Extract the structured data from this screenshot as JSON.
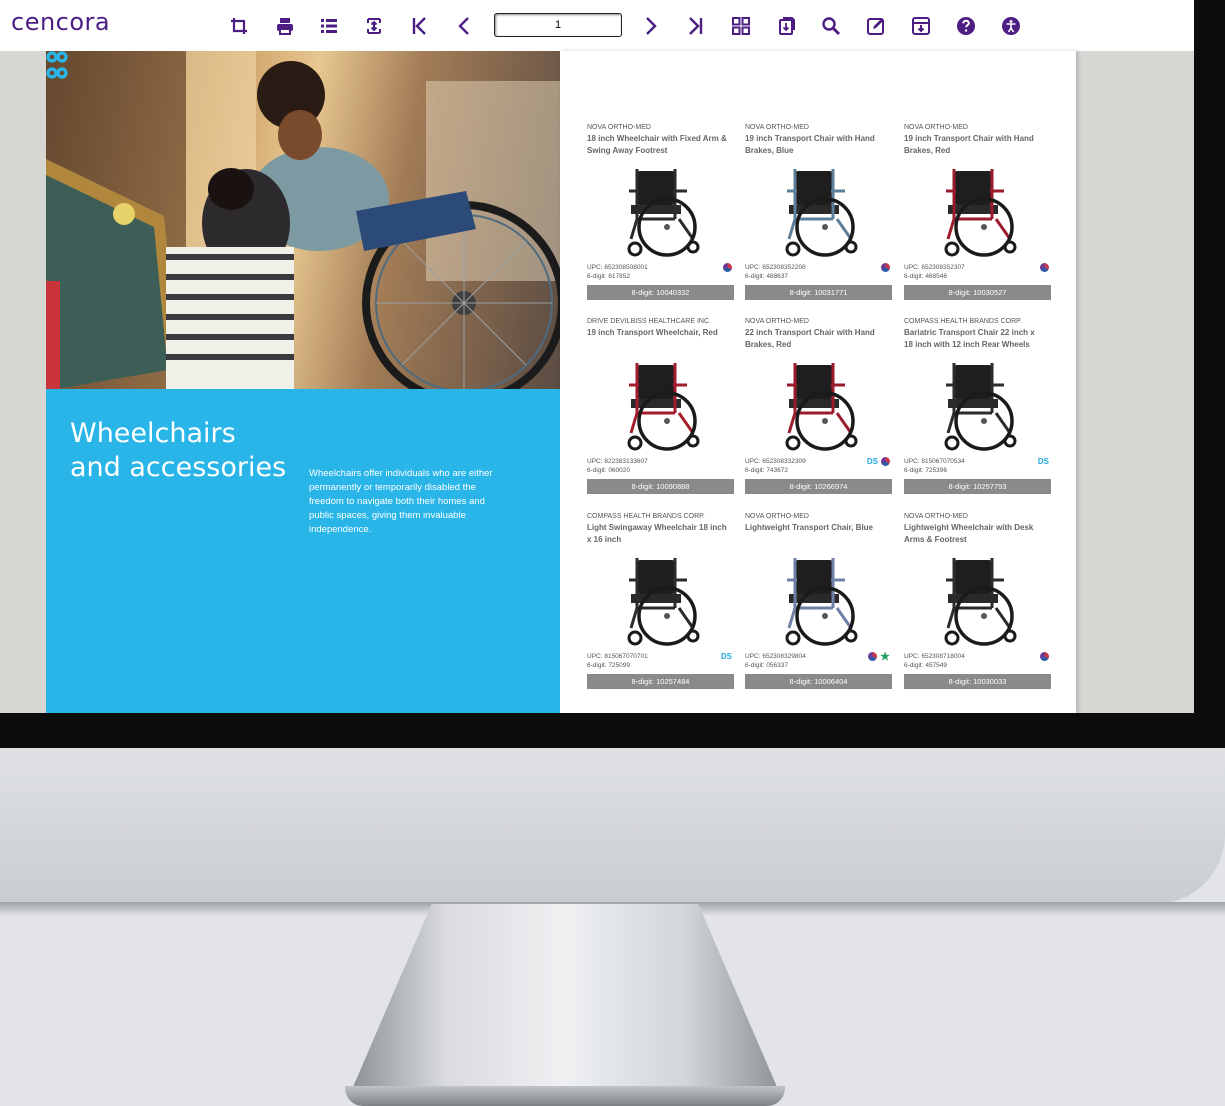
{
  "toolbar": {
    "brand": "cencora",
    "page_number": "1",
    "icons": [
      "crop-icon",
      "print-icon",
      "list-icon",
      "fit-page-icon",
      "first-page-icon",
      "previous-page-icon",
      "next-page-icon",
      "last-page-icon",
      "thumbnails-icon",
      "download-icon",
      "search-icon",
      "edit-icon",
      "archive-icon",
      "help-icon",
      "accessibility-icon"
    ]
  },
  "left_page": {
    "title_line1": "Wheelchairs",
    "title_line2": "and accessories",
    "description": "Wheelchairs offer individuals who are either permanently or temporarily disabled the freedom to navigate both their homes and public spaces, giving them invaluable independence."
  },
  "products": [
    {
      "brand": "NOVA ORTHO-MED",
      "name": "18 inch Wheelchair with Fixed Arm & Swing Away Footrest",
      "upc": "UPC: 652308508001",
      "six_digit": "6-digit: 617852",
      "eight_digit": "8-digit: 10040332",
      "badge_text": "",
      "globe": true,
      "star": false,
      "frame_color": "#2b2b2b"
    },
    {
      "brand": "NOVA ORTHO-MED",
      "name": "19 inch Transport Chair with Hand Brakes, Blue",
      "upc": "UPC: 652308352208",
      "six_digit": "6-digit: 488637",
      "eight_digit": "8-digit: 10031771",
      "badge_text": "",
      "globe": true,
      "star": false,
      "frame_color": "#5d7f99"
    },
    {
      "brand": "NOVA ORTHO-MED",
      "name": "19 inch Transport Chair with Hand Brakes, Red",
      "upc": "UPC: 652308352307",
      "six_digit": "6-digit: 468546",
      "eight_digit": "8-digit: 10030527",
      "badge_text": "",
      "globe": true,
      "star": false,
      "frame_color": "#9b1b2a"
    },
    {
      "brand": "DRIVE DEVILBISS HEALTHCARE INC",
      "name": "19 inch Transport Wheelchair, Red",
      "upc": "UPC: 822383133607",
      "six_digit": "6-digit: 060020",
      "eight_digit": "8-digit: 10090888",
      "badge_text": "",
      "globe": false,
      "star": false,
      "frame_color": "#a51d2d"
    },
    {
      "brand": "NOVA ORTHO-MED",
      "name": "22 inch Transport Chair with Hand Brakes, Red",
      "upc": "UPC: 652308332309",
      "six_digit": "6-digit: 743672",
      "eight_digit": "8-digit: 10266974",
      "badge_text": "DS",
      "globe": true,
      "star": false,
      "frame_color": "#9b1b2a"
    },
    {
      "brand": "COMPASS HEALTH BRANDS CORP.",
      "name": "Bariatric Transport Chair 22 inch x 18 inch with 12 inch Rear Wheels",
      "upc": "UPC: 815067070534",
      "six_digit": "6-digit: 725396",
      "eight_digit": "8-digit: 10257753",
      "badge_text": "DS",
      "globe": false,
      "star": false,
      "frame_color": "#2b2b2b"
    },
    {
      "brand": "COMPASS HEALTH BRANDS CORP.",
      "name": "Light Swingaway Wheelchair 18 inch x 16 inch",
      "upc": "UPC: 815067070701",
      "six_digit": "6-digit: 725099",
      "eight_digit": "8-digit: 10257484",
      "badge_text": "DS",
      "globe": false,
      "star": false,
      "frame_color": "#2b2b2b"
    },
    {
      "brand": "NOVA ORTHO-MED",
      "name": "Lightweight Transport Chair, Blue",
      "upc": "UPC: 652308329804",
      "six_digit": "6-digit: 056337",
      "eight_digit": "8-digit: 10006404",
      "badge_text": "",
      "globe": true,
      "star": true,
      "frame_color": "#6f7fa6"
    },
    {
      "brand": "NOVA ORTHO-MED",
      "name": "Lightweight Wheelchair with Desk Arms & Footrest",
      "upc": "UPC: 652308718004",
      "six_digit": "6-digit: 457549",
      "eight_digit": "8-digit: 10030033",
      "badge_text": "",
      "globe": true,
      "star": false,
      "frame_color": "#2b2b2b"
    }
  ],
  "colors": {
    "brand_purple": "#4c1e84",
    "section_blue": "#29b5e8",
    "code_bar": "#888a8c",
    "ds_badge": "#22aadd"
  }
}
